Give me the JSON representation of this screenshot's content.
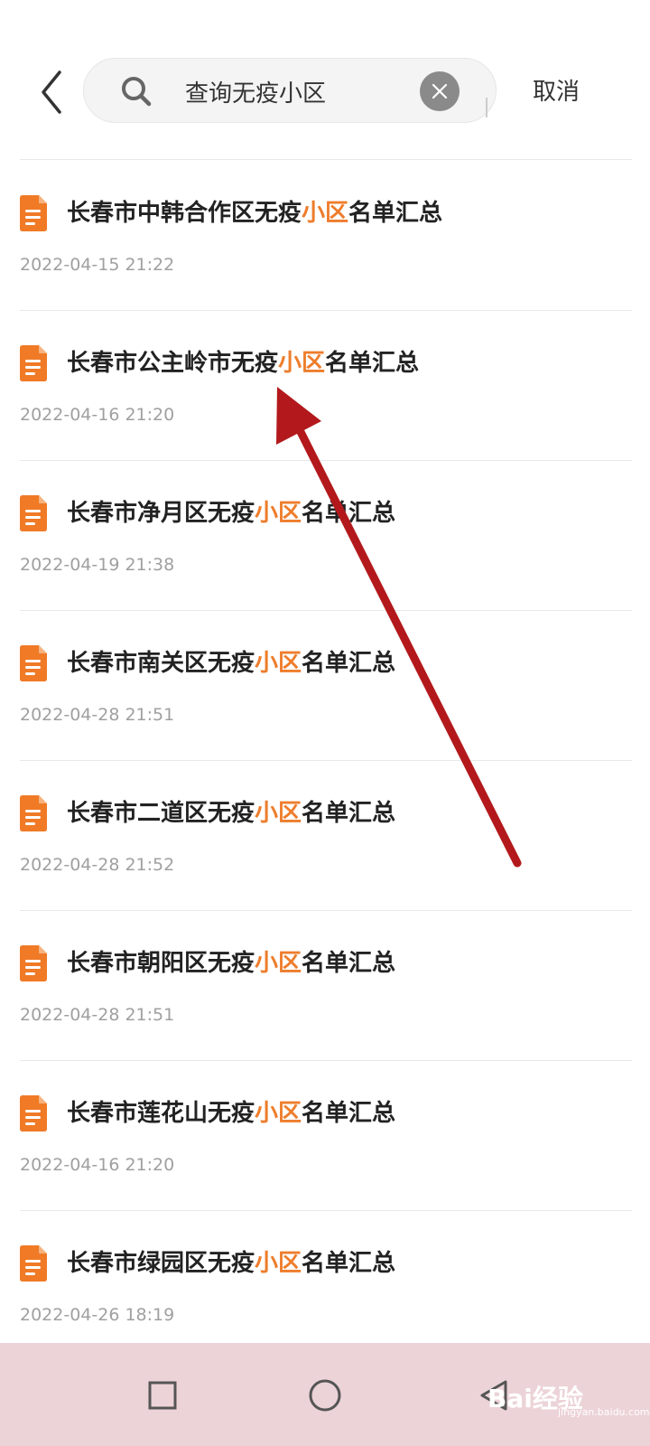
{
  "search": {
    "query": "查询无疫小区",
    "cancel_label": "取消"
  },
  "results": [
    {
      "prefix": "长春市中韩合作区无疫",
      "highlight": "小区",
      "suffix": "名单汇总",
      "date": "2022-04-15 21:22"
    },
    {
      "prefix": "长春市公主岭市无疫",
      "highlight": "小区",
      "suffix": "名单汇总",
      "date": "2022-04-16 21:20"
    },
    {
      "prefix": "长春市净月区无疫",
      "highlight": "小区",
      "suffix": "名单汇总",
      "date": "2022-04-19 21:38"
    },
    {
      "prefix": "长春市南关区无疫",
      "highlight": "小区",
      "suffix": "名单汇总",
      "date": "2022-04-28 21:51"
    },
    {
      "prefix": "长春市二道区无疫",
      "highlight": "小区",
      "suffix": "名单汇总",
      "date": "2022-04-28 21:52"
    },
    {
      "prefix": "长春市朝阳区无疫",
      "highlight": "小区",
      "suffix": "名单汇总",
      "date": "2022-04-28 21:51"
    },
    {
      "prefix": "长春市莲花山无疫",
      "highlight": "小区",
      "suffix": "名单汇总",
      "date": "2022-04-16 21:20"
    },
    {
      "prefix": "长春市绿园区无疫",
      "highlight": "小区",
      "suffix": "名单汇总",
      "date": "2022-04-26 18:19"
    }
  ],
  "colors": {
    "highlight": "#ee7d2c",
    "doc_icon": "#f07a26",
    "annotation_arrow": "#b3191c",
    "nav_bar": "#ecd3d7"
  },
  "icons": {
    "back": "chevron-left-icon",
    "search": "search-icon",
    "clear": "close-icon",
    "document": "document-icon",
    "nav_recent": "square-icon",
    "nav_home": "circle-icon",
    "nav_back": "triangle-back-icon"
  },
  "watermark": {
    "logo": "Bai经验",
    "url": "jingyan.baidu.com"
  }
}
